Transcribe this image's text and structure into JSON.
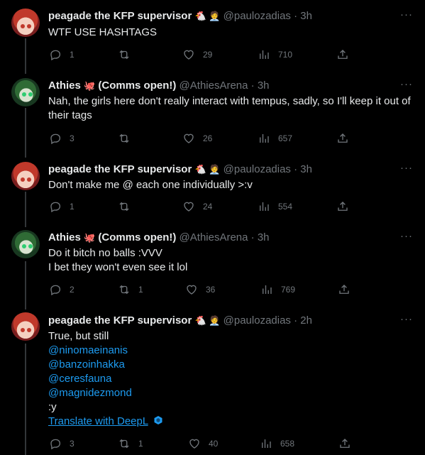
{
  "tweets": [
    {
      "name": "peagade the KFP supervisor",
      "emoji": "🐔 🧑‍💼",
      "handle": "@paulozadias",
      "time": "3h",
      "lines": [
        "WTF USE HASHTAGS"
      ],
      "replies": "1",
      "retweets": "",
      "likes": "29",
      "views": "710"
    },
    {
      "name": "Athies",
      "emoji": "🐙",
      "name_suffix": "(Comms open!)",
      "handle": "@AthiesArena",
      "time": "3h",
      "lines": [
        "Nah, the girls here don't really interact with tempus, sadly, so I'll keep it out of",
        "their tags"
      ],
      "replies": "3",
      "retweets": "",
      "likes": "26",
      "views": "657"
    },
    {
      "name": "peagade the KFP supervisor",
      "emoji": "🐔 🧑‍💼",
      "handle": "@paulozadias",
      "time": "3h",
      "lines": [
        "Don't make me @ each one individually >:v"
      ],
      "replies": "1",
      "retweets": "",
      "likes": "24",
      "views": "554"
    },
    {
      "name": "Athies",
      "emoji": "🐙",
      "name_suffix": "(Comms open!)",
      "handle": "@AthiesArena",
      "time": "3h",
      "lines": [
        "Do it bitch no balls :VVV",
        "I bet they won't even see it lol"
      ],
      "replies": "2",
      "retweets": "1",
      "likes": "36",
      "views": "769"
    },
    {
      "name": "peagade the KFP supervisor",
      "emoji": "🐔 🧑‍💼",
      "handle": "@paulozadias",
      "time": "2h",
      "lines": [
        "True, but still"
      ],
      "mentions": [
        "@ninomaeinanis",
        "@banzoinhakka",
        "@ceresfauna",
        "@magnidezmond"
      ],
      "tail": ":y",
      "translate": "Translate with DeepL",
      "replies": "3",
      "retweets": "1",
      "likes": "40",
      "views": "658"
    }
  ],
  "separator": "·",
  "more": "···"
}
